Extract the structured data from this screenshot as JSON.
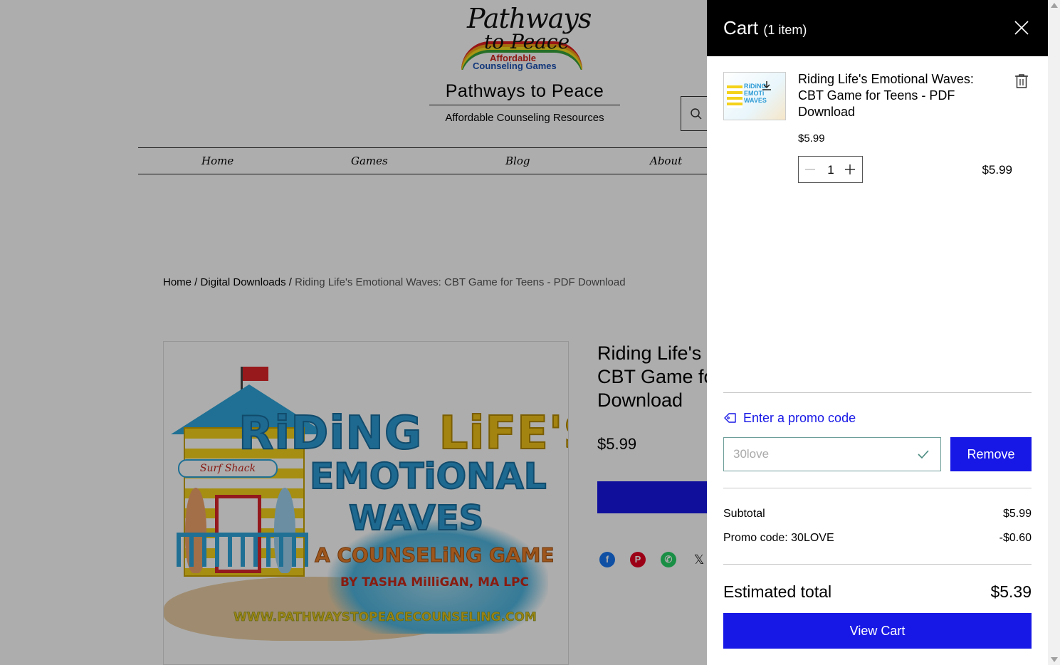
{
  "site": {
    "logo_text_line1": "Pathways",
    "logo_text_line2": "to Peace",
    "logo_sub1": "Affordable",
    "logo_sub2": "Counseling Games",
    "title": "Pathways to Peace",
    "tagline": "Affordable Counseling Resources"
  },
  "nav": {
    "items": [
      {
        "label": "Home"
      },
      {
        "label": "Games"
      },
      {
        "label": "Blog"
      },
      {
        "label": "About"
      }
    ]
  },
  "breadcrumb": {
    "home": "Home",
    "sep1": " / ",
    "category": "Digital Downloads",
    "sep2": " / ",
    "current": "Riding Life's Emotional Waves: CBT Game for Teens - PDF Download"
  },
  "product": {
    "title_lines": [
      "Riding Life's",
      "CBT Game fo",
      "Download"
    ],
    "price": "$5.99",
    "image_text": {
      "line1_a": "RiDiNG ",
      "line1_b": "LiFE'S",
      "line2": "EMOTiONAL",
      "line3": "WAVES",
      "line4": "A COUNSELiNG GAME",
      "author": "BY TASHA MilliGAN, MA LPC",
      "url": "WWW.PATHWAYSTOPEACECOUNSELING.COM",
      "sign": "Surf Shack"
    },
    "share_icons": [
      "facebook-icon",
      "pinterest-icon",
      "whatsapp-icon",
      "x-icon"
    ]
  },
  "cart": {
    "title": "Cart",
    "count": "(1 item)",
    "item": {
      "name": "Riding Life's Emotional Waves: CBT Game for Teens - PDF Download",
      "thumb_text": "RiDiNG EMOTi WAVES",
      "unit_price": "$5.99",
      "quantity": "1",
      "line_total": "$5.99"
    },
    "promo": {
      "link_label": "Enter a promo code",
      "input_value": "30love",
      "remove_label": "Remove"
    },
    "summary": {
      "subtotal_label": "Subtotal",
      "subtotal_value": "$5.99",
      "promo_label": "Promo code: 30LOVE",
      "promo_value": "-$0.60",
      "estimated_label": "Estimated total",
      "estimated_value": "$5.39"
    },
    "view_cart_label": "View Cart"
  },
  "colors": {
    "accent": "#1717e6",
    "header_bg": "#000000",
    "facebook": "#1877f2",
    "pinterest": "#e60023",
    "whatsapp": "#25d366"
  }
}
